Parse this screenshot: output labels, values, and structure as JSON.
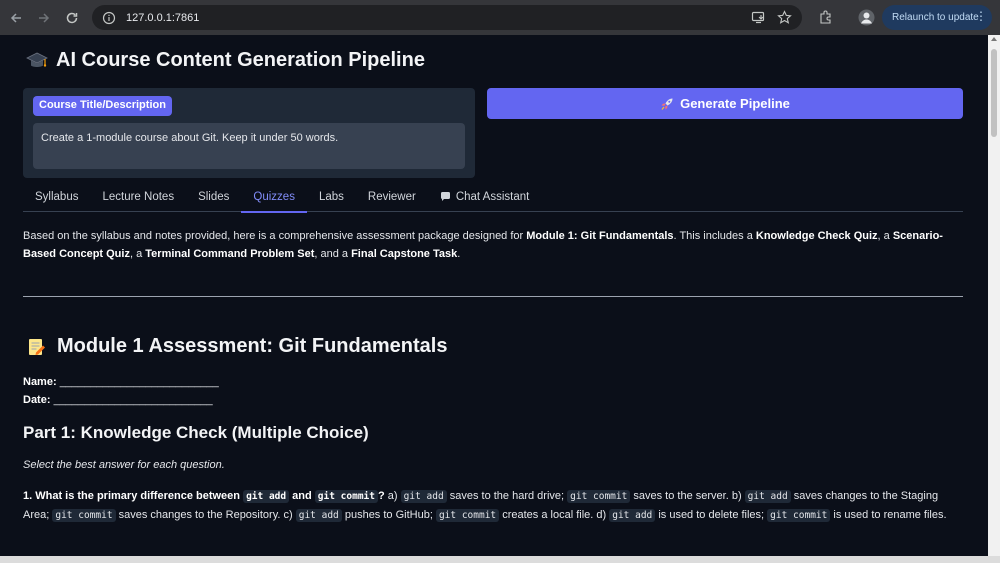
{
  "browser": {
    "url": "127.0.0.1:7861",
    "relaunch_label": "Relaunch to update"
  },
  "app": {
    "title": "AI Course Content Generation Pipeline",
    "input_label": "Course Title/Description",
    "input_value": "Create a 1-module course about Git. Keep it under 50 words.",
    "generate_button": "Generate Pipeline"
  },
  "tabs": [
    {
      "label": "Syllabus",
      "active": false
    },
    {
      "label": "Lecture Notes",
      "active": false
    },
    {
      "label": "Slides",
      "active": false
    },
    {
      "label": "Quizzes",
      "active": true
    },
    {
      "label": "Labs",
      "active": false
    },
    {
      "label": "Reviewer",
      "active": false
    },
    {
      "label": "Chat Assistant",
      "active": false
    }
  ],
  "quiz": {
    "intro": {
      "p1": "Based on the syllabus and notes provided, here is a comprehensive assessment package designed for ",
      "b1": "Module 1: Git Fundamentals",
      "p2": ". This includes a ",
      "b2": "Knowledge Check Quiz",
      "p3": ", a ",
      "b3": "Scenario-Based Concept Quiz",
      "p4": ", a ",
      "b4": "Terminal Command Problem Set",
      "p5": ", and a ",
      "b5": "Final Capstone Task",
      "p6": "."
    },
    "heading": "Module 1 Assessment: Git Fundamentals",
    "name_label": "Name:",
    "name_blank": "__________________________",
    "date_label": "Date:",
    "date_blank": "__________________________",
    "part1_heading": "Part 1: Knowledge Check (Multiple Choice)",
    "part1_instruction": "Select the best answer for each question.",
    "q1": {
      "q_a": "1. What is the primary difference between ",
      "q_code1": "git add",
      "q_and": " and ",
      "q_code2": "git commit",
      "q_end": "?",
      "s1": " a) ",
      "c1": "git add",
      "s2": " saves to the hard drive; ",
      "c2": "git commit",
      "s3": " saves to the server. b) ",
      "c3": "git add",
      "s4": " saves changes to the Staging Area; ",
      "c4": "git commit",
      "s5": " saves changes to the Repository. c) ",
      "c5": "git add",
      "s6": " pushes to GitHub; ",
      "c6": "git commit",
      "s7": " creates a local file. d) ",
      "c7": "git add",
      "s8": " is used to delete files; ",
      "c8": "git commit",
      "s9": " is used to rename files."
    }
  },
  "colors": {
    "accent": "#6366f1",
    "background": "#0b0f19",
    "panel": "#1f2937"
  }
}
